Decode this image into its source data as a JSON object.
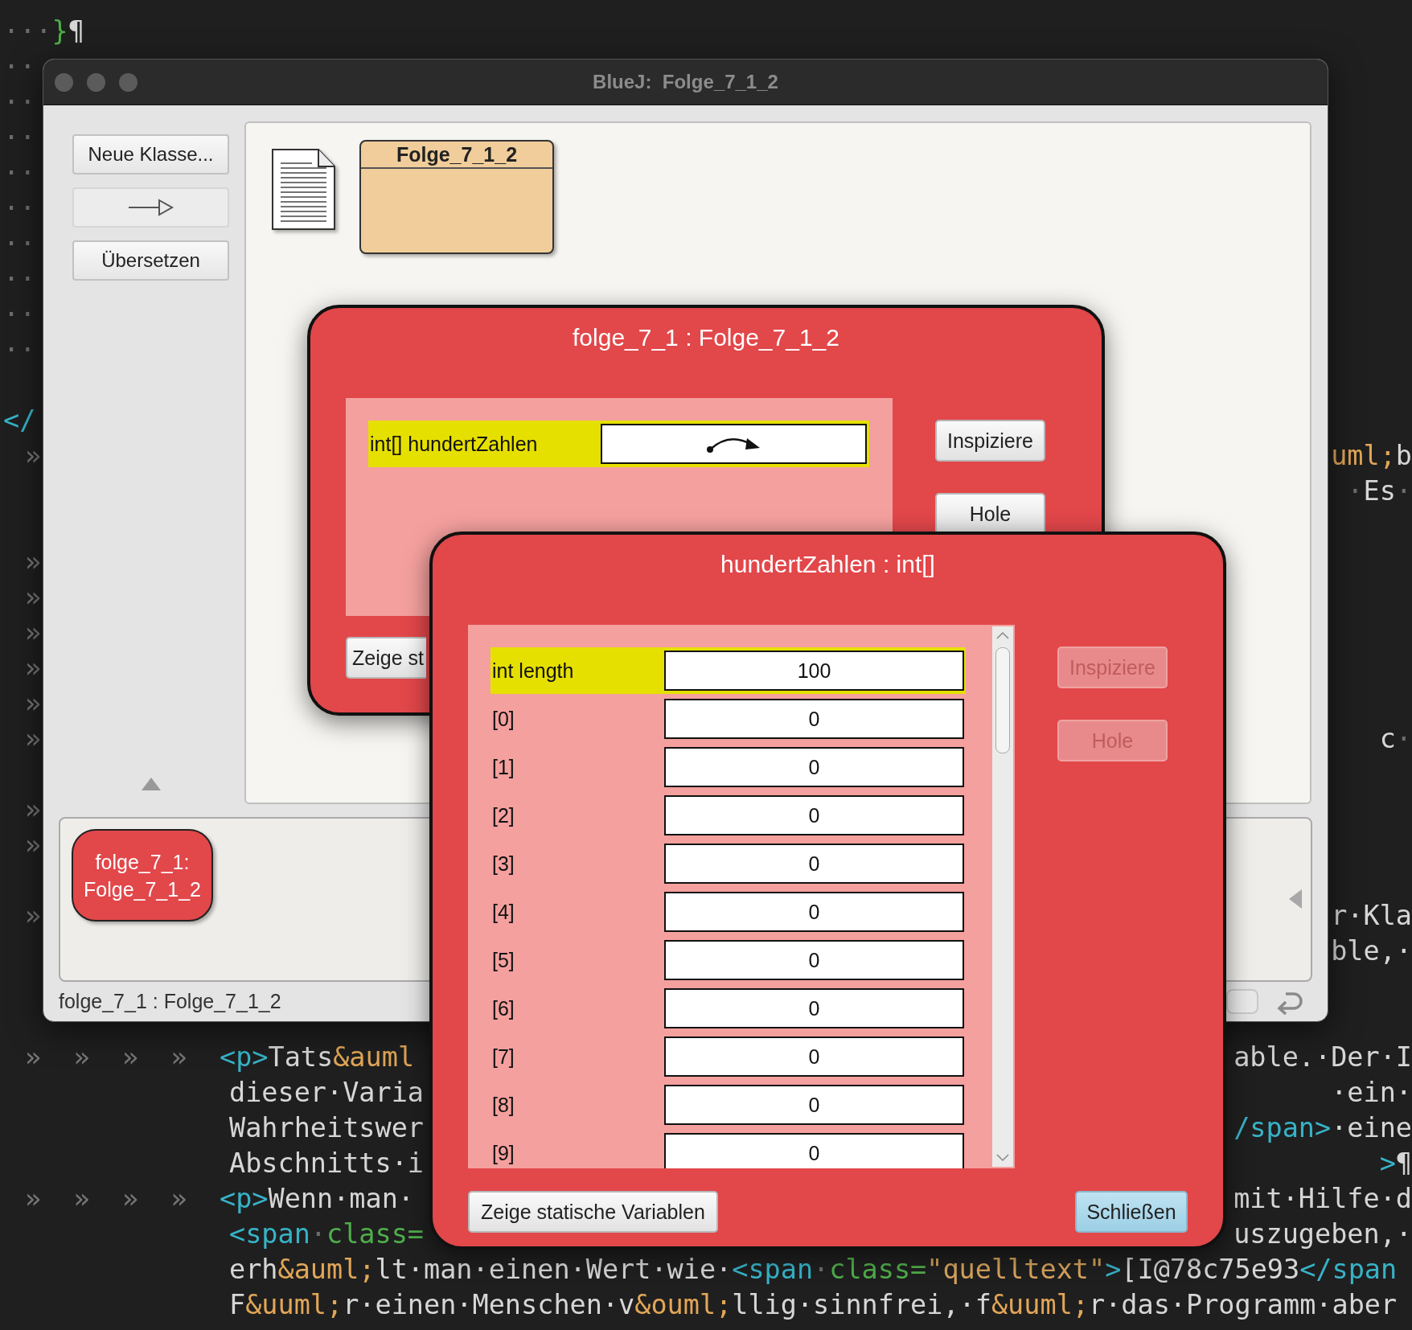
{
  "editor": {
    "lines": [
      {
        "kind": "blank"
      },
      {
        "kind": "plain",
        "left": [
          {
            "text": "···",
            "kind": "ws"
          },
          {
            "text": "}",
            "kind": "attr"
          },
          {
            "text": "¶",
            "kind": "text"
          }
        ]
      },
      {
        "kind": "plain",
        "left": [
          {
            "text": "··",
            "kind": "ws"
          }
        ]
      },
      {
        "kind": "plain",
        "left": [
          {
            "text": "··",
            "kind": "ws"
          }
        ]
      },
      {
        "kind": "plain",
        "left": [
          {
            "text": "··",
            "kind": "ws"
          }
        ]
      },
      {
        "kind": "plain",
        "left": [
          {
            "text": "··",
            "kind": "ws"
          }
        ]
      },
      {
        "kind": "plain",
        "left": [
          {
            "text": "··",
            "kind": "ws"
          }
        ]
      },
      {
        "kind": "plain",
        "left": [
          {
            "text": "··",
            "kind": "ws"
          }
        ]
      },
      {
        "kind": "plain",
        "left": [
          {
            "text": "··",
            "kind": "ws"
          }
        ]
      },
      {
        "kind": "plain",
        "left": [
          {
            "text": "··",
            "kind": "ws"
          }
        ]
      },
      {
        "kind": "plain",
        "left": [
          {
            "text": "··",
            "kind": "ws"
          }
        ]
      },
      {
        "kind": "blank"
      },
      {
        "kind": "plain",
        "left": [
          {
            "text": "</",
            "kind": "tag"
          }
        ]
      },
      {
        "kind": "tabbed",
        "left": [
          {
            "text": "»",
            "kind": "tab"
          }
        ],
        "right": [
          {
            "text": "uml;",
            "kind": "entity"
          },
          {
            "text": "b",
            "kind": "text"
          }
        ]
      },
      {
        "right": [
          {
            "text": "·",
            "kind": "ws"
          },
          {
            "text": "Es",
            "kind": "text"
          },
          {
            "text": "·",
            "kind": "ws"
          }
        ]
      },
      {
        "kind": "blank"
      },
      {
        "kind": "tabbed",
        "left": [
          {
            "text": "»",
            "kind": "tab"
          }
        ]
      },
      {
        "kind": "tabbed",
        "left": [
          {
            "text": "»",
            "kind": "tab"
          }
        ]
      },
      {
        "kind": "tabbed",
        "left": [
          {
            "text": "»",
            "kind": "tab"
          }
        ]
      },
      {
        "kind": "tabbed",
        "left": [
          {
            "text": "»",
            "kind": "tab"
          }
        ]
      },
      {
        "kind": "tabbed",
        "left": [
          {
            "text": "»",
            "kind": "tab"
          }
        ]
      },
      {
        "kind": "tabbed",
        "left": [
          {
            "text": "»",
            "kind": "tab"
          }
        ],
        "right": [
          {
            "text": "c",
            "kind": "text"
          },
          {
            "text": "·",
            "kind": "ws"
          }
        ]
      },
      {
        "kind": "blank"
      },
      {
        "kind": "tabbed",
        "left": [
          {
            "text": "»",
            "kind": "tab"
          }
        ]
      },
      {
        "kind": "tabbed",
        "left": [
          {
            "text": "»",
            "kind": "tab"
          }
        ]
      },
      {
        "kind": "blank"
      },
      {
        "kind": "tabbed",
        "left": [
          {
            "text": "»",
            "kind": "tab"
          }
        ],
        "right": [
          {
            "text": "r·Kla",
            "kind": "text"
          }
        ]
      },
      {
        "right": [
          {
            "text": "ble,·",
            "kind": "text"
          }
        ]
      },
      {
        "kind": "blank"
      },
      {
        "kind": "blank"
      },
      {
        "kind": "tabbed",
        "left": [
          {
            "text": "»",
            "kind": "tab"
          },
          {
            "text": "»",
            "kind": "tab"
          },
          {
            "text": "»",
            "kind": "tab"
          },
          {
            "text": "»",
            "kind": "tab"
          },
          {
            "text": "<p>",
            "kind": "tag"
          },
          {
            "text": "Tats",
            "kind": "text"
          },
          {
            "text": "&auml",
            "kind": "entity"
          }
        ],
        "right": [
          {
            "text": "able.·Der·I",
            "kind": "text"
          }
        ]
      },
      {
        "kind": "continuation",
        "left": [
          {
            "text": "dieser·Varia",
            "kind": "text"
          }
        ],
        "right": [
          {
            "text": "·ein·",
            "kind": "text"
          }
        ]
      },
      {
        "kind": "continuation",
        "left": [
          {
            "text": "Wahrheitswer",
            "kind": "text"
          }
        ],
        "right": [
          {
            "text": "/span>",
            "kind": "tag"
          },
          {
            "text": "·eine",
            "kind": "text"
          }
        ]
      },
      {
        "kind": "continuation",
        "left": [
          {
            "text": "Abschnitts·i",
            "kind": "text"
          }
        ],
        "right": [
          {
            "text": ">",
            "kind": "tag"
          },
          {
            "text": "¶",
            "kind": "text"
          }
        ]
      },
      {
        "kind": "tabbed",
        "left": [
          {
            "text": "»",
            "kind": "tab"
          },
          {
            "text": "»",
            "kind": "tab"
          },
          {
            "text": "»",
            "kind": "tab"
          },
          {
            "text": "»",
            "kind": "tab"
          },
          {
            "text": "<p>",
            "kind": "tag"
          },
          {
            "text": "Wenn·man·",
            "kind": "text"
          }
        ],
        "right": [
          {
            "text": "mit·Hilfe·d",
            "kind": "text"
          }
        ]
      },
      {
        "kind": "continuation",
        "left": [
          {
            "text": "<span",
            "kind": "tag"
          },
          {
            "text": "·",
            "kind": "ws"
          },
          {
            "text": "class=",
            "kind": "attr"
          }
        ],
        "right": [
          {
            "text": "uszugeben,·",
            "kind": "text"
          }
        ]
      },
      {
        "kind": "continuation",
        "left": [
          {
            "text": "erh",
            "kind": "text"
          },
          {
            "text": "&auml;",
            "kind": "entity"
          },
          {
            "text": "lt·man·einen·Wert·wie·",
            "kind": "text"
          },
          {
            "text": "<span",
            "kind": "tag"
          },
          {
            "text": "·",
            "kind": "ws"
          },
          {
            "text": "class=",
            "kind": "attr"
          },
          {
            "text": "\"quelltext\"",
            "kind": "string"
          },
          {
            "text": ">",
            "kind": "tag"
          },
          {
            "text": "[I@78c75e93",
            "kind": "text"
          },
          {
            "text": "</span",
            "kind": "tag"
          }
        ]
      },
      {
        "kind": "continuation",
        "left": [
          {
            "text": "F",
            "kind": "text"
          },
          {
            "text": "&uuml;",
            "kind": "entity"
          },
          {
            "text": "r·einen·Menschen·v",
            "kind": "text"
          },
          {
            "text": "&ouml;",
            "kind": "entity"
          },
          {
            "text": "llig·sinnfrei,·f",
            "kind": "text"
          },
          {
            "text": "&uuml;",
            "kind": "entity"
          },
          {
            "text": "r·das·Programm·aber",
            "kind": "text"
          }
        ]
      }
    ]
  },
  "main_window": {
    "title": "BlueJ:  Folge_7_1_2",
    "toolbar": [
      {
        "kind": "text",
        "label": "Neue Klasse..."
      },
      {
        "kind": "arrow"
      },
      {
        "kind": "text",
        "label": "Übersetzen"
      }
    ],
    "diagram": {
      "classes": [
        {
          "name": "Folge_7_1_2"
        }
      ]
    },
    "object_bench": {
      "objects": [
        {
          "name": "folge_7_1:",
          "type": "Folge_7_1_2"
        }
      ]
    },
    "status_bar": {
      "text": "folge_7_1 : Folge_7_1_2"
    }
  },
  "object_inspector": {
    "title": "folge_7_1 : Folge_7_1_2",
    "fields": [
      {
        "label": "int[] hundertZahlen",
        "kind": "reference",
        "selected": true
      }
    ],
    "buttons": [
      {
        "label": "Inspiziere",
        "disabled": false
      },
      {
        "label": "Hole",
        "disabled": false
      }
    ],
    "footer_buttons": [
      {
        "label": "Zeige st",
        "kind": "plain"
      }
    ]
  },
  "array_inspector": {
    "title": "hundertZahlen : int[]",
    "fields": [
      {
        "label": "int length",
        "kind": "value",
        "value": "100",
        "selected": true
      },
      {
        "label": "[0]",
        "kind": "value",
        "value": "0",
        "selected": false
      },
      {
        "label": "[1]",
        "kind": "value",
        "value": "0",
        "selected": false
      },
      {
        "label": "[2]",
        "kind": "value",
        "value": "0",
        "selected": false
      },
      {
        "label": "[3]",
        "kind": "value",
        "value": "0",
        "selected": false
      },
      {
        "label": "[4]",
        "kind": "value",
        "value": "0",
        "selected": false
      },
      {
        "label": "[5]",
        "kind": "value",
        "value": "0",
        "selected": false
      },
      {
        "label": "[6]",
        "kind": "value",
        "value": "0",
        "selected": false
      },
      {
        "label": "[7]",
        "kind": "value",
        "value": "0",
        "selected": false
      },
      {
        "label": "[8]",
        "kind": "value",
        "value": "0",
        "selected": false
      },
      {
        "label": "[9]",
        "kind": "value",
        "value": "0",
        "selected": false
      }
    ],
    "buttons": [
      {
        "label": "Inspiziere",
        "disabled": true
      },
      {
        "label": "Hole",
        "disabled": true
      }
    ],
    "footer_buttons": [
      {
        "label": "Zeige statische Variablen",
        "kind": "plain"
      },
      {
        "label": "Schließen",
        "kind": "default"
      }
    ]
  }
}
